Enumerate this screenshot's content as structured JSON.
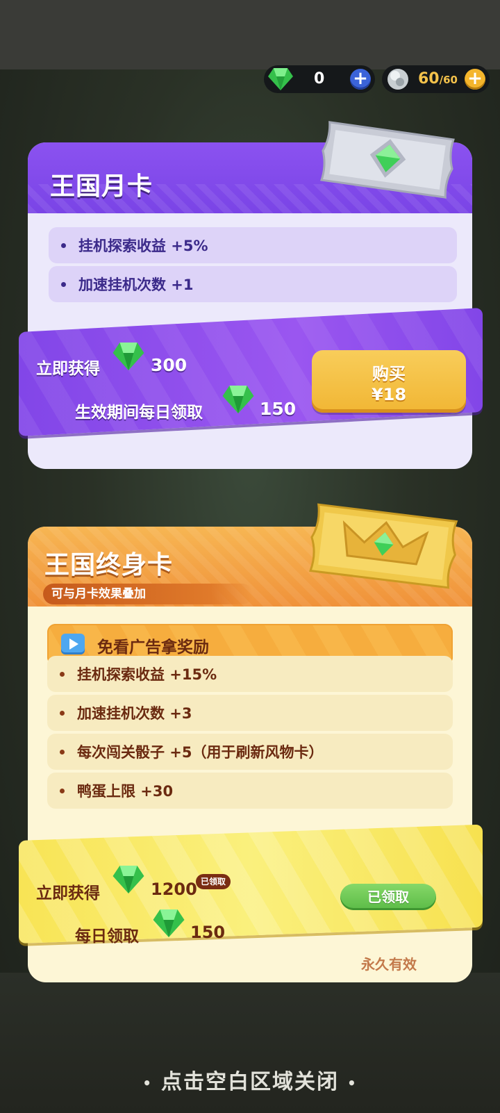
{
  "currency": {
    "gems": "0",
    "energy_current": "60",
    "energy_max": "/60",
    "plus": "+"
  },
  "monthly_card": {
    "title": "王国月卡",
    "features": [
      "挂机探索收益 +5%",
      "加速挂机次数 +1"
    ],
    "instant_label": "立即获得",
    "instant_amount": "300",
    "daily_label": "生效期间每日领取",
    "daily_amount": "150",
    "buy_label": "购买",
    "price": "¥18"
  },
  "lifetime_card": {
    "title": "王国终身卡",
    "subtitle": "可与月卡效果叠加",
    "ad_free": "免看广告拿奖励",
    "features": [
      "挂机探索收益 +15%",
      "加速挂机次数 +3",
      "每次闯关骰子 +5（用于刷新风物卡）",
      "鸭蛋上限 +30"
    ],
    "instant_label": "立即获得",
    "instant_amount": "1200",
    "claimed_tag": "已领取",
    "daily_label": "每日领取",
    "daily_amount": "150",
    "claim_button": "已领取",
    "validity": "永久有效"
  },
  "close_hint": "点击空白区域关闭",
  "colors": {
    "purple": "#8b52f0",
    "orange": "#f0923a",
    "gold_button": "#f1b634",
    "green_button": "#5bbb47"
  }
}
